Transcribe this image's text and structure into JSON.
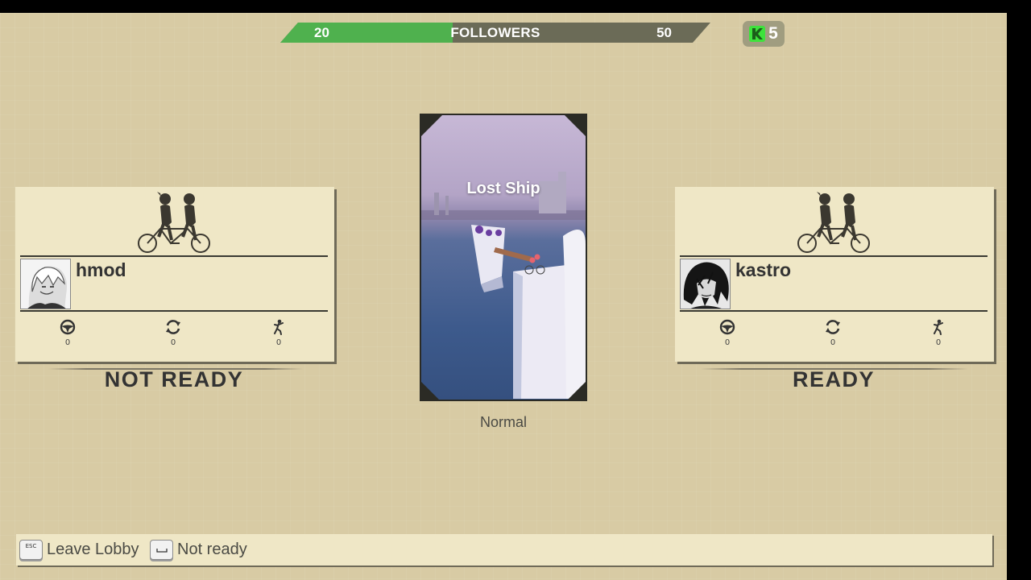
{
  "followers": {
    "current": "20",
    "label": "FOLLOWERS",
    "max": "50",
    "progress": 0.4,
    "fill_color": "#4fb14e"
  },
  "k_badge": {
    "icon": "k-logo-icon",
    "count": "5",
    "icon_color": "#3ee23c"
  },
  "players": [
    {
      "name": "hmod",
      "status": "NOT READY",
      "stats": [
        {
          "icon": "steering-wheel-icon",
          "value": "0"
        },
        {
          "icon": "refresh-icon",
          "value": "0"
        },
        {
          "icon": "running-figure-icon",
          "value": "0"
        }
      ]
    },
    {
      "name": "kastro",
      "status": "READY",
      "stats": [
        {
          "icon": "steering-wheel-icon",
          "value": "0"
        },
        {
          "icon": "refresh-icon",
          "value": "0"
        },
        {
          "icon": "running-figure-icon",
          "value": "0"
        }
      ]
    }
  ],
  "level": {
    "name": "Lost Ship",
    "difficulty": "Normal"
  },
  "controls": [
    {
      "key": "ESC",
      "label": "Leave Lobby"
    },
    {
      "key": "",
      "label": "Not ready"
    }
  ]
}
